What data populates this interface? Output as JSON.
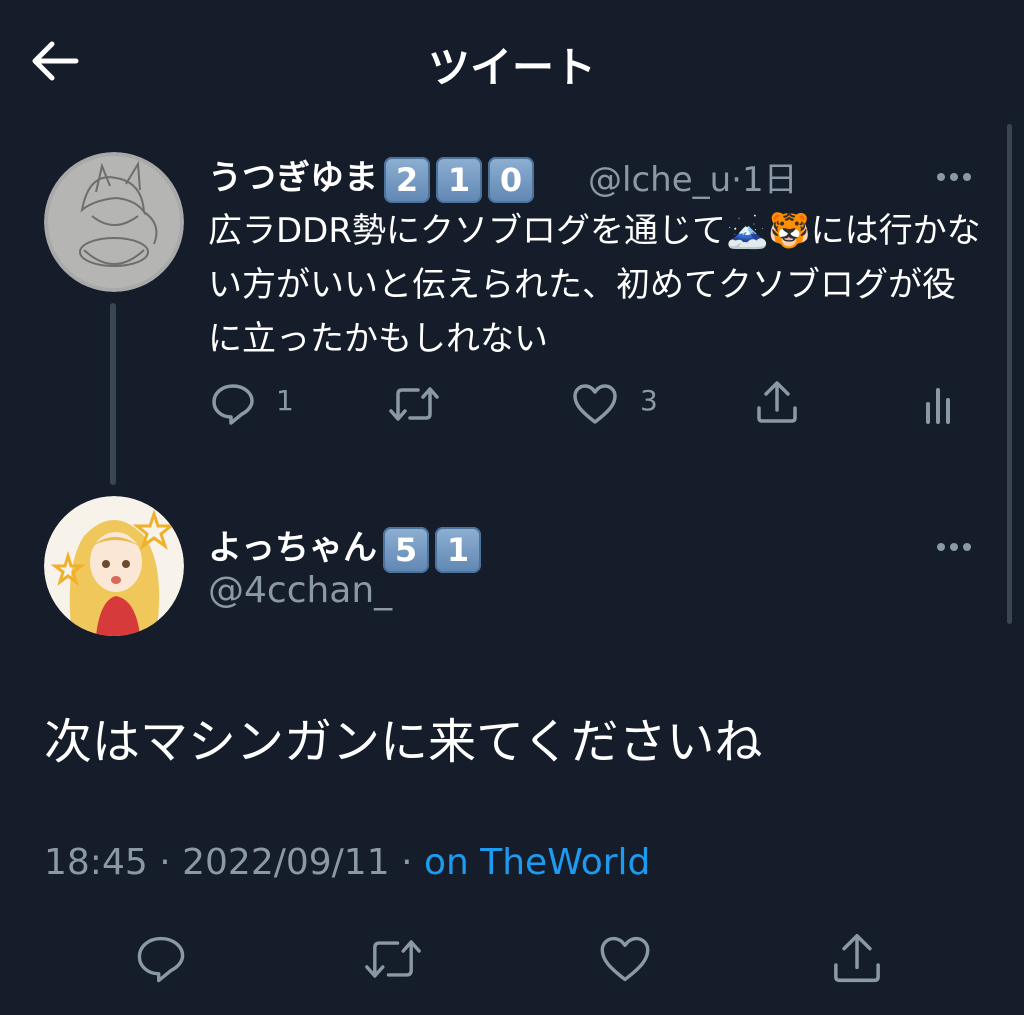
{
  "header": {
    "title": "ツイート",
    "back_icon": "arrow-left-icon"
  },
  "tweets": [
    {
      "name": "うつぎゆま",
      "badges": [
        "2",
        "1",
        "0"
      ],
      "handle": "@lche_u",
      "sep": "·",
      "time": "1日",
      "text": "広ラDDR勢にクソブログを通じて🗻🐯には行かない方がいいと伝えられた、初めてクソブログが役に立ったかもしれない",
      "actions": {
        "reply_count": "1",
        "retweet_count": "",
        "like_count": "3"
      }
    },
    {
      "name": "よっちゃん",
      "badges": [
        "5",
        "1"
      ],
      "handle": "@4cchan_",
      "text": "次はマシンガンに来てくださいね",
      "time": "18:45",
      "date": "2022/09/11",
      "sep": "·",
      "client": "on TheWorld"
    }
  ],
  "colors": {
    "background": "#151d2a",
    "text": "#e7e9ea",
    "muted": "#8b98a5",
    "link": "#1d9bf0",
    "accent_keycap": "#6a90bb"
  }
}
